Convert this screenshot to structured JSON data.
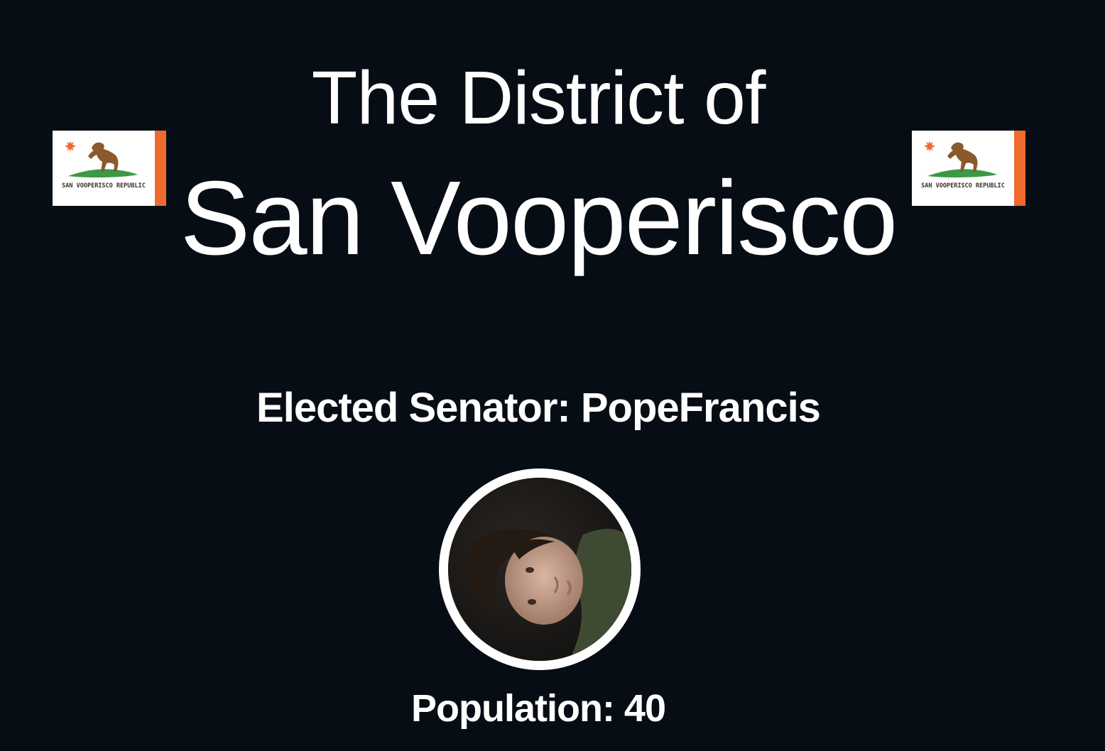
{
  "header": {
    "title_line1": "The District of",
    "title_line2": "San Vooperisco"
  },
  "flags": {
    "caption": "SAN VOOPERISCO REPUBLIC",
    "colors": {
      "background": "#ffffff",
      "stripe": "#ef6a2e",
      "star": "#ef6a2e",
      "ground": "#3a9a44",
      "horse": "#8a5a2c"
    }
  },
  "senator": {
    "label": "Elected Senator: PopeFrancis"
  },
  "population": {
    "label": "Population: 40"
  },
  "theme": {
    "background": "#070d14",
    "text": "#ffffff"
  }
}
